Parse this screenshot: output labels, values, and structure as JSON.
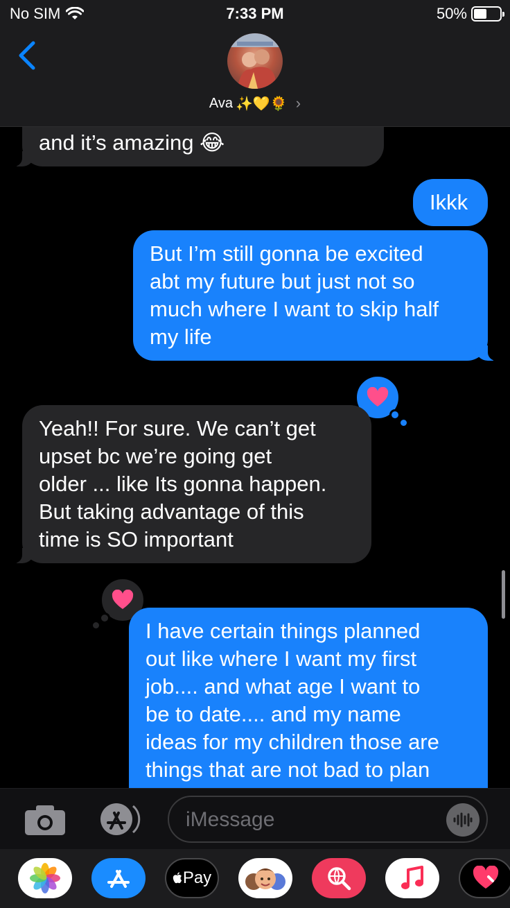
{
  "status_bar": {
    "carrier": "No SIM",
    "time": "7:33 PM",
    "battery_percent": "50%",
    "battery_level": 0.5
  },
  "header": {
    "contact_name": "Ava",
    "contact_emojis": "✨💛🌻",
    "chevron": "›"
  },
  "messages": [
    {
      "side": "received",
      "lines": [
        "and it’s amazing 😂"
      ]
    },
    {
      "side": "sent",
      "lines": [
        "Ikkk"
      ]
    },
    {
      "side": "sent",
      "lines": [
        "But I’m still gonna be excited",
        "abt my future but just not so",
        "much where I want to skip half",
        "my life"
      ],
      "tapback": "heart"
    },
    {
      "side": "received",
      "lines": [
        "Yeah!! For sure. We can’t get",
        "upset bc we’re going get",
        "older ... like Its gonna happen.",
        "But taking advantage of this",
        "time is SO important"
      ],
      "tapback": "heart"
    },
    {
      "side": "sent",
      "lines": [
        "I have certain things planned",
        "out like where I want my first",
        "job.... and what age I want to",
        "be to date.... and my name",
        "ideas for my children those are",
        "things that are not bad to plan"
      ]
    }
  ],
  "input_bar": {
    "placeholder": "iMessage",
    "camera_icon": "camera-icon",
    "apps_icon": "appstore-icon",
    "audio_icon": "audio-waveform-icon"
  },
  "app_drawer": {
    "apps": [
      {
        "name": "photos-icon"
      },
      {
        "name": "appstore-icon"
      },
      {
        "name": "apple-pay-icon",
        "label": "Pay"
      },
      {
        "name": "memoji-icon"
      },
      {
        "name": "web-search-icon"
      },
      {
        "name": "music-icon"
      },
      {
        "name": "digital-touch-icon"
      }
    ]
  },
  "colors": {
    "sent_bubble": "#1982fc",
    "received_bubble": "#262628",
    "accent": "#0a84ff",
    "heart": "#ff4f8b"
  }
}
